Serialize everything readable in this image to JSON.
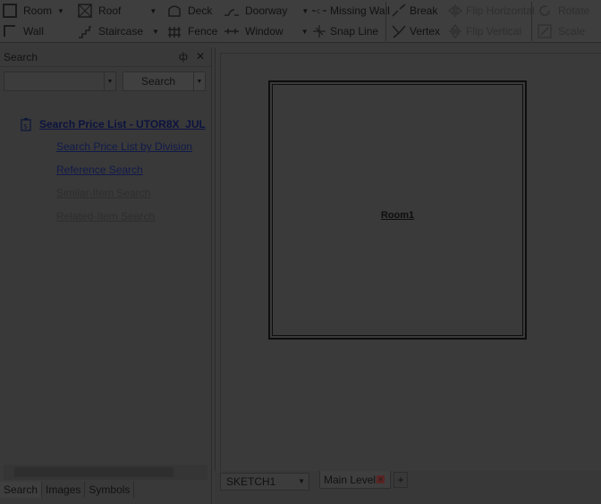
{
  "ribbon": {
    "room": "Room",
    "wall": "Wall",
    "roof": "Roof",
    "staircase": "Staircase",
    "deck": "Deck",
    "fence": "Fence",
    "doorway": "Doorway",
    "window": "Window",
    "missing_wall": "Missing Wall",
    "snap_line": "Snap Line",
    "break": "Break",
    "vertex": "Vertex",
    "flip_horizontal": "Flip Horizontal",
    "flip_vertical": "Flip Vertical",
    "rotate": "Rotate",
    "scale": "Scale"
  },
  "left_panel": {
    "title": "Search",
    "search_input_value": "",
    "search_button": "Search",
    "tree": {
      "root": "Search Price List - UTOR8X_JUL",
      "items": [
        {
          "label": "Search Price List by Division",
          "enabled": true
        },
        {
          "label": "Reference Search",
          "enabled": true
        },
        {
          "label": "Similar-Item Search",
          "enabled": false
        },
        {
          "label": "Related-Item Search",
          "enabled": false
        }
      ]
    },
    "bottom_tabs": [
      "Search",
      "Images",
      "Symbols"
    ]
  },
  "canvas": {
    "room_label": "Room1"
  },
  "bottom_bar": {
    "sketch_select": "SKETCH1",
    "level_tab": "Main Level",
    "add_tab": "+"
  }
}
